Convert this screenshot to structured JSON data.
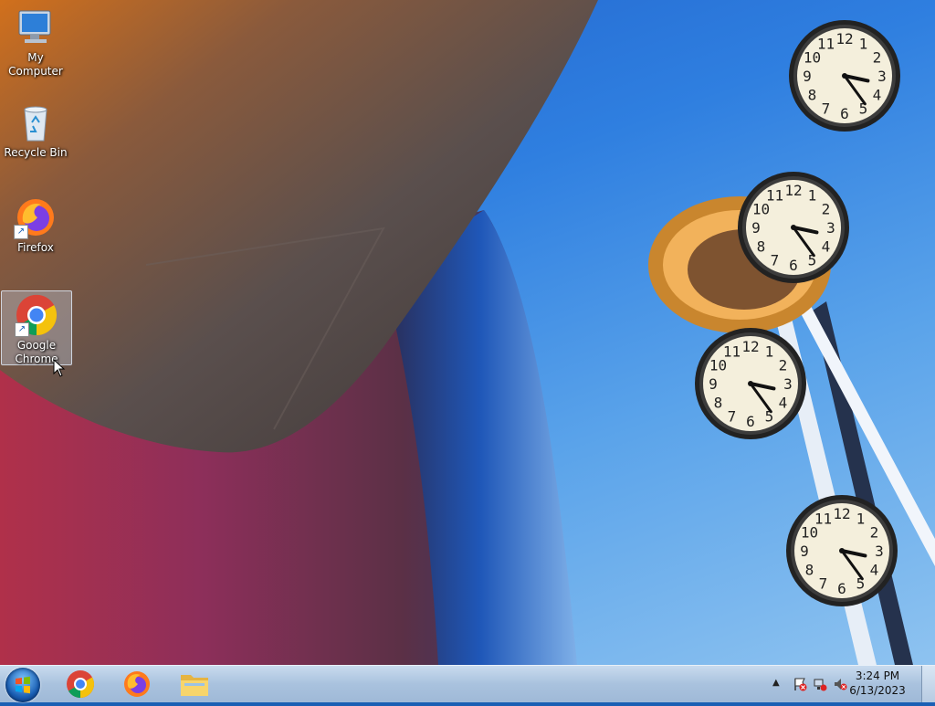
{
  "desktop": {
    "icons": [
      {
        "label": "My Computer",
        "icon": "computer-icon"
      },
      {
        "label": "Recycle Bin",
        "icon": "recycle-bin-icon"
      },
      {
        "label": "Firefox",
        "icon": "firefox-icon"
      },
      {
        "label": "Google Chrome",
        "icon": "chrome-icon",
        "selected": true
      }
    ]
  },
  "clocks": [
    {
      "hour": 3,
      "minute": 24
    },
    {
      "hour": 3,
      "minute": 24
    },
    {
      "hour": 3,
      "minute": 24
    },
    {
      "hour": 3,
      "minute": 24
    }
  ],
  "taskbar": {
    "pinned": [
      {
        "name": "Google Chrome",
        "icon": "chrome-icon"
      },
      {
        "name": "Firefox",
        "icon": "firefox-icon"
      },
      {
        "name": "Windows Explorer",
        "icon": "folder-icon"
      }
    ],
    "tray": {
      "time": "3:24 PM",
      "date": "6/13/2023"
    }
  },
  "colors": {
    "taskbar": "#a9c2de",
    "sky": "#2f7fe0",
    "building_dark": "#4a4342",
    "building_orange": "#c2611d"
  }
}
